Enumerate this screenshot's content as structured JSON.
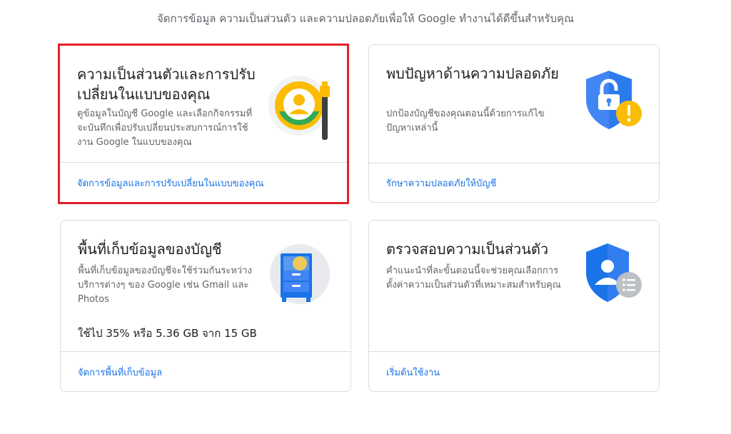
{
  "header": {
    "subtitle": "จัดการข้อมูล ความเป็นส่วนตัว และความปลอดภัยเพื่อให้ Google ทำงานได้ดีขึ้นสำหรับคุณ"
  },
  "cards": [
    {
      "title": "ความเป็นส่วนตัวและการปรับเปลี่ยนในแบบของคุณ",
      "description": "ดูข้อมูลในบัญชี Google และเลือกกิจกรรมที่จะบันทึกเพื่อปรับเปลี่ยนประสบการณ์การใช้งาน Google ในแบบของคุณ",
      "link": "จัดการข้อมูลและการปรับเปลี่ยนในแบบของคุณ",
      "icon": "privacy-personalization-icon"
    },
    {
      "title": "พบปัญหาด้านความปลอดภัย",
      "description": "ปกป้องบัญชีของคุณตอนนี้ด้วยการแก้ไขปัญหาเหล่านี้",
      "link": "รักษาความปลอดภัยให้บัญชี",
      "icon": "security-issue-icon"
    },
    {
      "title": "พื้นที่เก็บข้อมูลของบัญชี",
      "description": "พื้นที่เก็บข้อมูลของบัญชีจะใช้ร่วมกันระหว่างบริการต่างๆ ของ Google เช่น Gmail และ Photos",
      "usage": "ใช้ไป 35% หรือ 5.36 GB จาก 15 GB",
      "used_percent": 35,
      "link": "จัดการพื้นที่เก็บข้อมูล",
      "icon": "storage-cabinet-icon"
    },
    {
      "title": "ตรวจสอบความเป็นส่วนตัว",
      "description": "คำแนะนำที่ละขั้นตอนนี้จะช่วยคุณเลือกการตั้งค่าความเป็นส่วนตัวที่เหมาะสมสำหรับคุณ",
      "link": "เริ่มต้นใช้งาน",
      "icon": "privacy-checkup-icon"
    }
  ],
  "colors": {
    "link": "#1a73e8",
    "highlight": "#e3202a",
    "google_blue": "#4285f4",
    "google_yellow": "#fbbc04",
    "google_green": "#34a853"
  }
}
